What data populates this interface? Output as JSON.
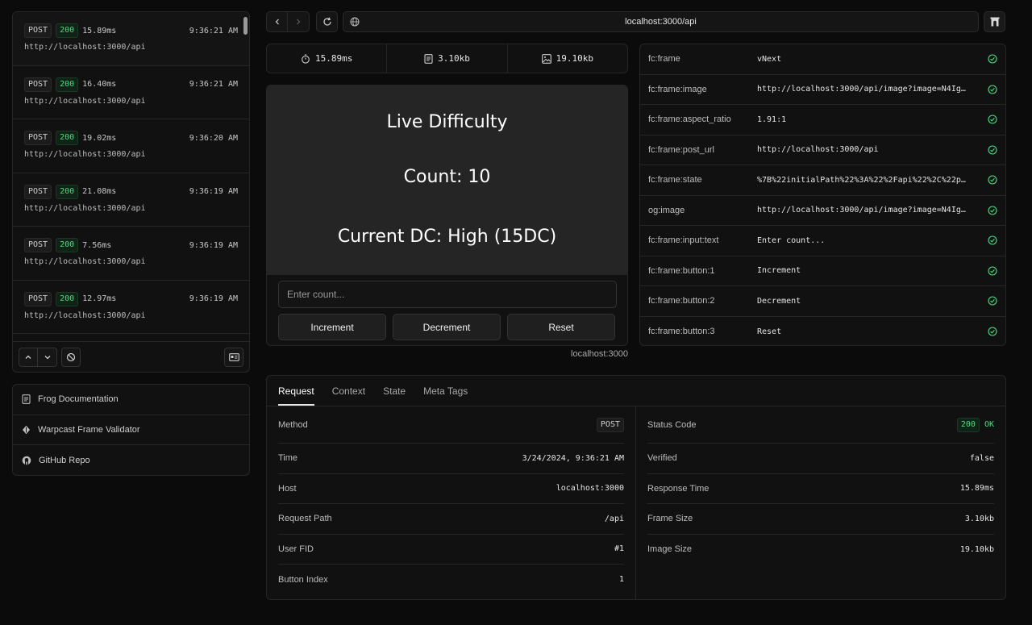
{
  "log": {
    "entries": [
      {
        "method": "POST",
        "status": "200",
        "duration": "15.89ms",
        "time": "9:36:21 AM",
        "url": "http://localhost:3000/api"
      },
      {
        "method": "POST",
        "status": "200",
        "duration": "16.40ms",
        "time": "9:36:21 AM",
        "url": "http://localhost:3000/api"
      },
      {
        "method": "POST",
        "status": "200",
        "duration": "19.02ms",
        "time": "9:36:20 AM",
        "url": "http://localhost:3000/api"
      },
      {
        "method": "POST",
        "status": "200",
        "duration": "21.08ms",
        "time": "9:36:19 AM",
        "url": "http://localhost:3000/api"
      },
      {
        "method": "POST",
        "status": "200",
        "duration": "7.56ms",
        "time": "9:36:19 AM",
        "url": "http://localhost:3000/api"
      },
      {
        "method": "POST",
        "status": "200",
        "duration": "12.97ms",
        "time": "9:36:19 AM",
        "url": "http://localhost:3000/api"
      }
    ]
  },
  "links": [
    {
      "label": "Frog Documentation",
      "icon": "document-icon"
    },
    {
      "label": "Warpcast Frame Validator",
      "icon": "warpcast-icon"
    },
    {
      "label": "GitHub Repo",
      "icon": "github-icon"
    }
  ],
  "topbar": {
    "url": "localhost:3000/api"
  },
  "metrics": {
    "time": "15.89ms",
    "frame_size": "3.10kb",
    "image_size": "19.10kb"
  },
  "frame": {
    "title": "Live Difficulty",
    "count": "Count: 10",
    "dc": "Current DC: High (15DC)",
    "input_placeholder": "Enter count...",
    "buttons": [
      "Increment",
      "Decrement",
      "Reset"
    ],
    "host": "localhost:3000"
  },
  "meta_tags": [
    {
      "key": "fc:frame",
      "value": "vNext"
    },
    {
      "key": "fc:frame:image",
      "value": "http://localhost:3000/api/image?image=N4Ig…"
    },
    {
      "key": "fc:frame:aspect_ratio",
      "value": "1.91:1"
    },
    {
      "key": "fc:frame:post_url",
      "value": "http://localhost:3000/api"
    },
    {
      "key": "fc:frame:state",
      "value": "%7B%22initialPath%22%3A%22%2Fapi%22%2C%22p…"
    },
    {
      "key": "og:image",
      "value": "http://localhost:3000/api/image?image=N4Ig…"
    },
    {
      "key": "fc:frame:input:text",
      "value": "Enter count..."
    },
    {
      "key": "fc:frame:button:1",
      "value": "Increment"
    },
    {
      "key": "fc:frame:button:2",
      "value": "Decrement"
    },
    {
      "key": "fc:frame:button:3",
      "value": "Reset"
    }
  ],
  "inspector": {
    "tabs": [
      "Request",
      "Context",
      "State",
      "Meta Tags"
    ],
    "active_tab": "Request",
    "left": [
      {
        "key": "Method",
        "value": "POST"
      },
      {
        "key": "Time",
        "value": "3/24/2024, 9:36:21 AM"
      },
      {
        "key": "Host",
        "value": "localhost:3000"
      },
      {
        "key": "Request Path",
        "value": "/api"
      },
      {
        "key": "User FID",
        "value": "#1"
      },
      {
        "key": "Button Index",
        "value": "1"
      }
    ],
    "right": [
      {
        "key": "Status Code",
        "value": "200",
        "status_text": "OK"
      },
      {
        "key": "Verified",
        "value": "false"
      },
      {
        "key": "Response Time",
        "value": "15.89ms"
      },
      {
        "key": "Frame Size",
        "value": "3.10kb"
      },
      {
        "key": "Image Size",
        "value": "19.10kb"
      }
    ]
  },
  "colors": {
    "background": "#0b0b0b",
    "panel": "#111111",
    "accent_green": "#4ade80",
    "frame_bg": "#252525"
  }
}
